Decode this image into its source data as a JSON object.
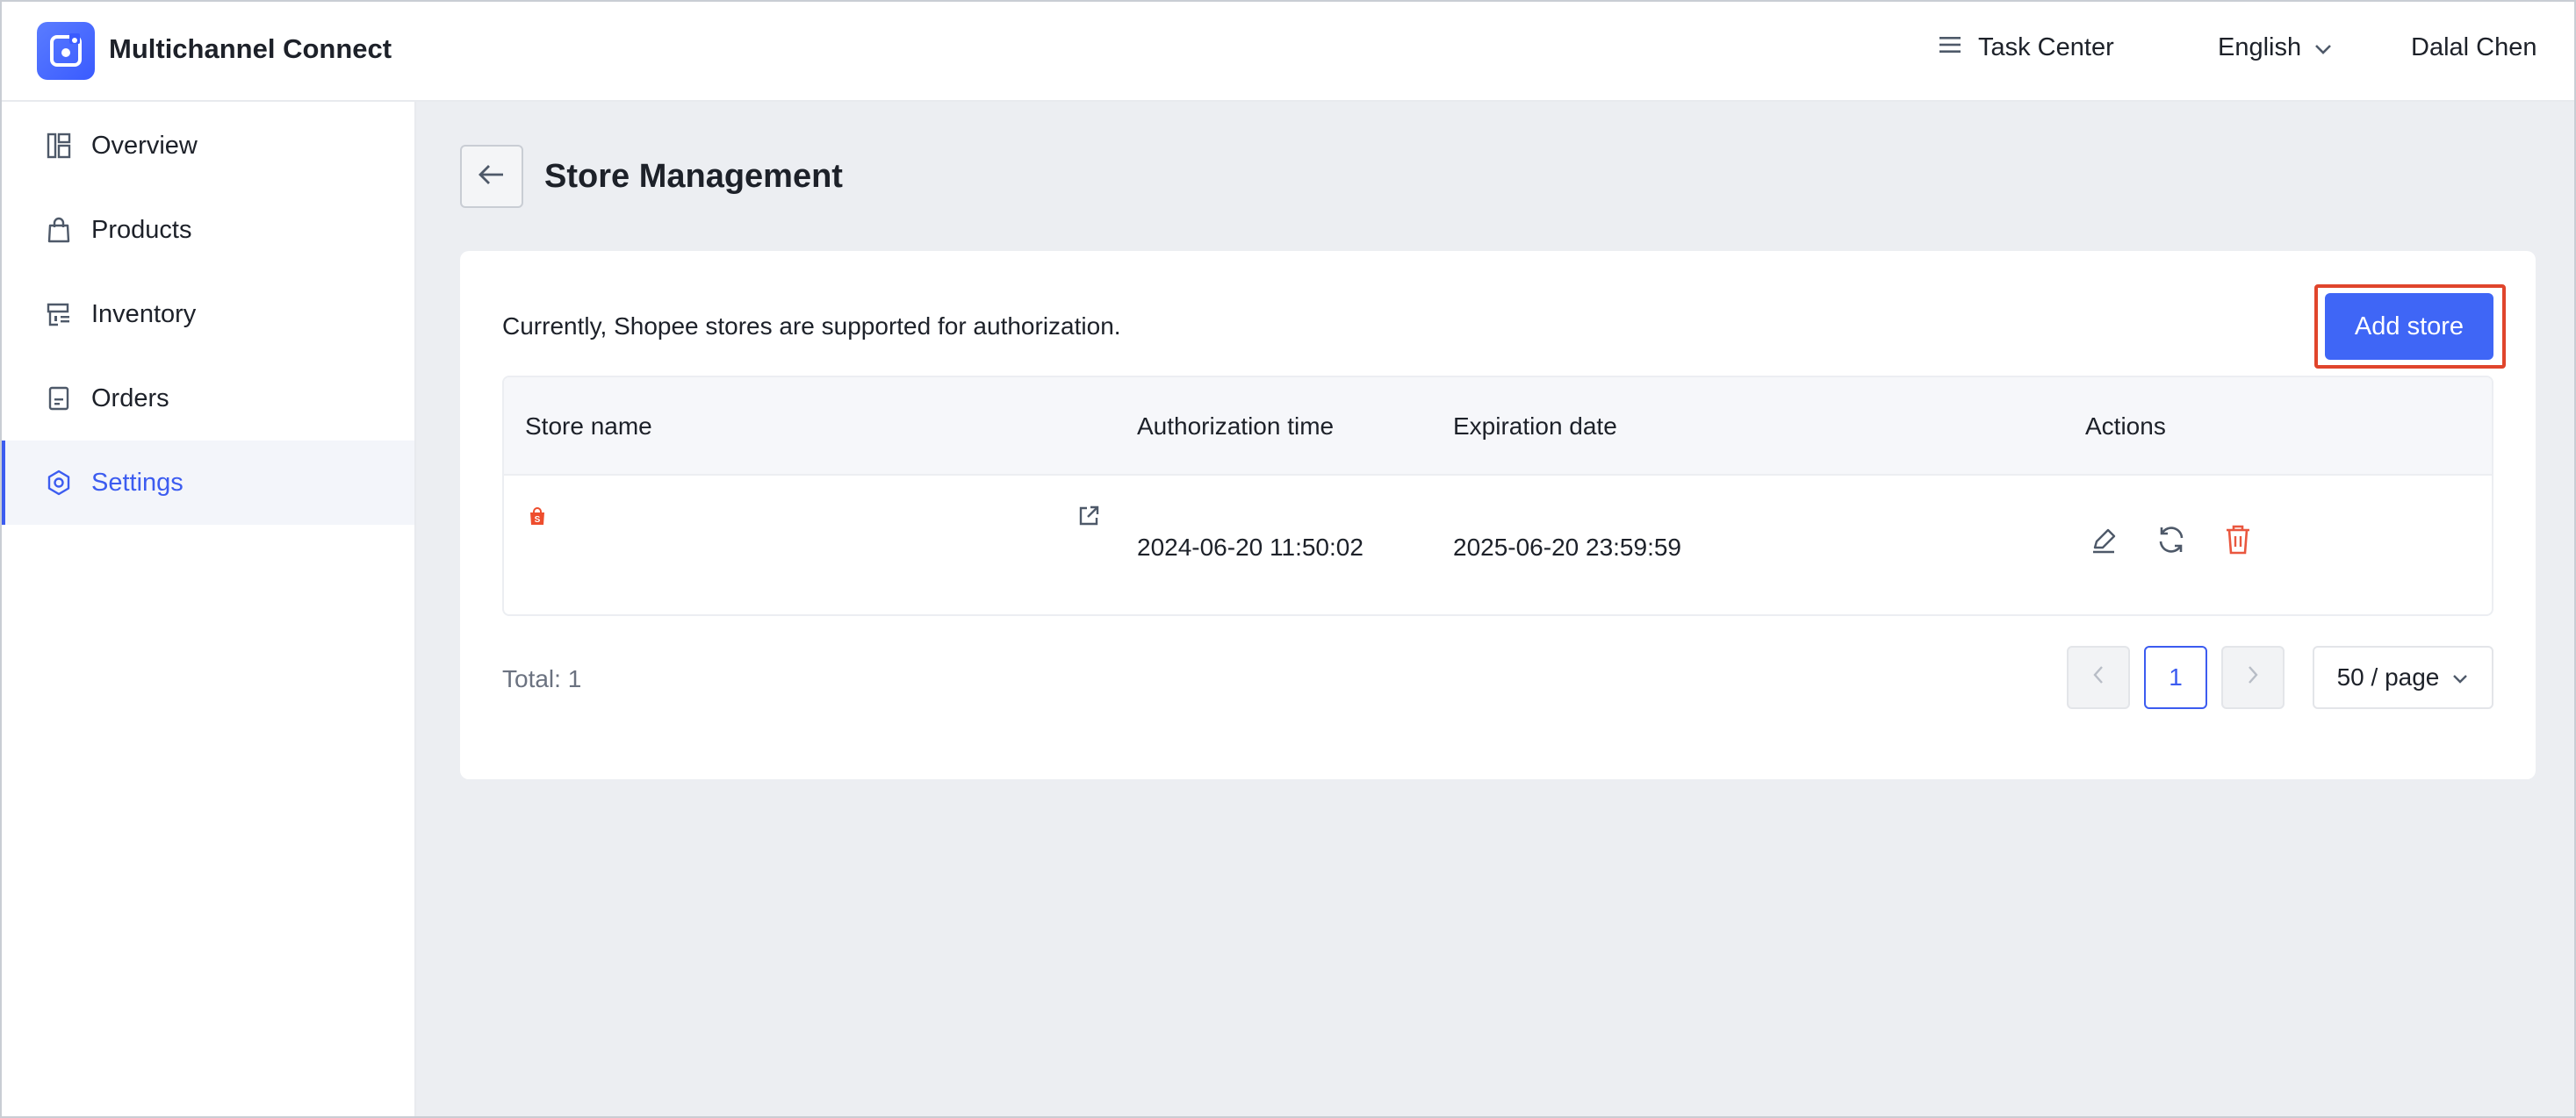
{
  "header": {
    "app_title": "Multichannel Connect",
    "task_center": "Task Center",
    "language": "English",
    "user_name": "Dalal Chen"
  },
  "sidebar": {
    "items": [
      {
        "label": "Overview",
        "icon": "overview-icon",
        "active": false
      },
      {
        "label": "Products",
        "icon": "shopping-bag-icon",
        "active": false
      },
      {
        "label": "Inventory",
        "icon": "store-icon",
        "active": false
      },
      {
        "label": "Orders",
        "icon": "document-icon",
        "active": false
      },
      {
        "label": "Settings",
        "icon": "settings-icon",
        "active": true
      }
    ]
  },
  "main": {
    "page_title": "Store Management",
    "notice": "Currently, Shopee stores are supported for authorization.",
    "add_store_label": "Add store",
    "table": {
      "columns": [
        "Store name",
        "Authorization time",
        "Expiration date",
        "Actions"
      ],
      "rows": [
        {
          "store_name": "",
          "authorization_time": "2024-06-20 11:50:02",
          "expiration_date": "2025-06-20 23:59:59"
        }
      ]
    },
    "pagination": {
      "total": "Total: 1",
      "current_page": "1",
      "page_size": "50 / page"
    }
  },
  "colors": {
    "accent": "#3f66f6",
    "highlight": "#e0452c",
    "delete": "#e9573f",
    "shopee": "#ee4d2d"
  }
}
